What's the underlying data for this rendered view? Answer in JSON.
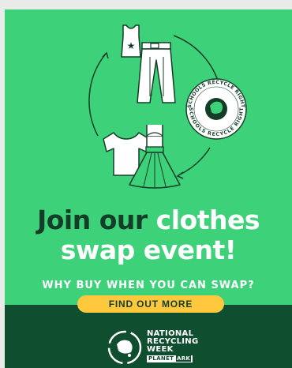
{
  "headline": {
    "part1": "Join our",
    "part2": "clothes",
    "part3": "swap event!"
  },
  "tagline": "WHY BUY WHEN YOU CAN SWAP?",
  "cta_label": "FIND OUT MORE",
  "badge": {
    "text_top": "SCHOOLS RECYCLE RIGHT",
    "text_bottom": "SCHOOLS RECYCLE RIGHT"
  },
  "footer_logo": {
    "line1": "NATIONAL",
    "line2": "RECYCLING",
    "line3": "WEEK",
    "brand_part1": "PLANET",
    "brand_part2": "ARK"
  },
  "colors": {
    "background_green": "#3dd17a",
    "footer_green": "#0f4f30",
    "headline_dark": "#143d27",
    "cta_yellow": "#ffc83d"
  }
}
